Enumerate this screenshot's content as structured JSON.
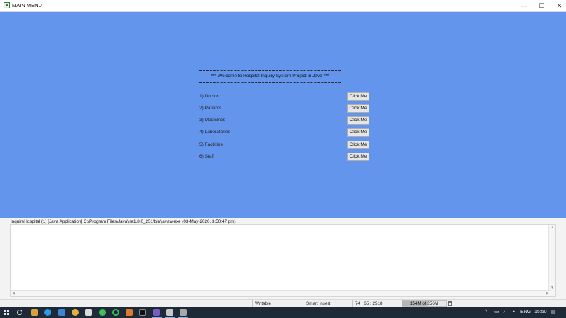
{
  "window": {
    "title": "MAIN MENU",
    "controls": {
      "minimize": "—",
      "maximize": "☐",
      "close": "✕"
    }
  },
  "menu": {
    "welcome": "*** Welcome to Hospital Inquiry System Project in Java ***",
    "items": [
      {
        "label": "1) Doctor",
        "button": "Click Me"
      },
      {
        "label": "2) Patients",
        "button": "Click Me"
      },
      {
        "label": "3) Medicines",
        "button": "Click Me"
      },
      {
        "label": "4) Laboratories",
        "button": "Click Me"
      },
      {
        "label": "5) Facilities",
        "button": "Click Me"
      },
      {
        "label": "6) Staff",
        "button": "Click Me"
      }
    ]
  },
  "console": {
    "header": "InquireHospital (1) [Java Application] C:\\Program Files\\Java\\jre1.8.0_251\\bin\\javaw.exe (03-May-2020, 3:50:47 pm)"
  },
  "statusbar": {
    "mode": "Writable",
    "insert": "Smart Insert",
    "position": "74 : 65 : 2518",
    "heap": "154M of 256M",
    "heap_fraction": 0.6
  },
  "taskbar": {
    "language": "ENG",
    "time": "15:50"
  },
  "colors": {
    "window_bg": "#6495ed",
    "taskbar_bg": "#1f2a38"
  }
}
